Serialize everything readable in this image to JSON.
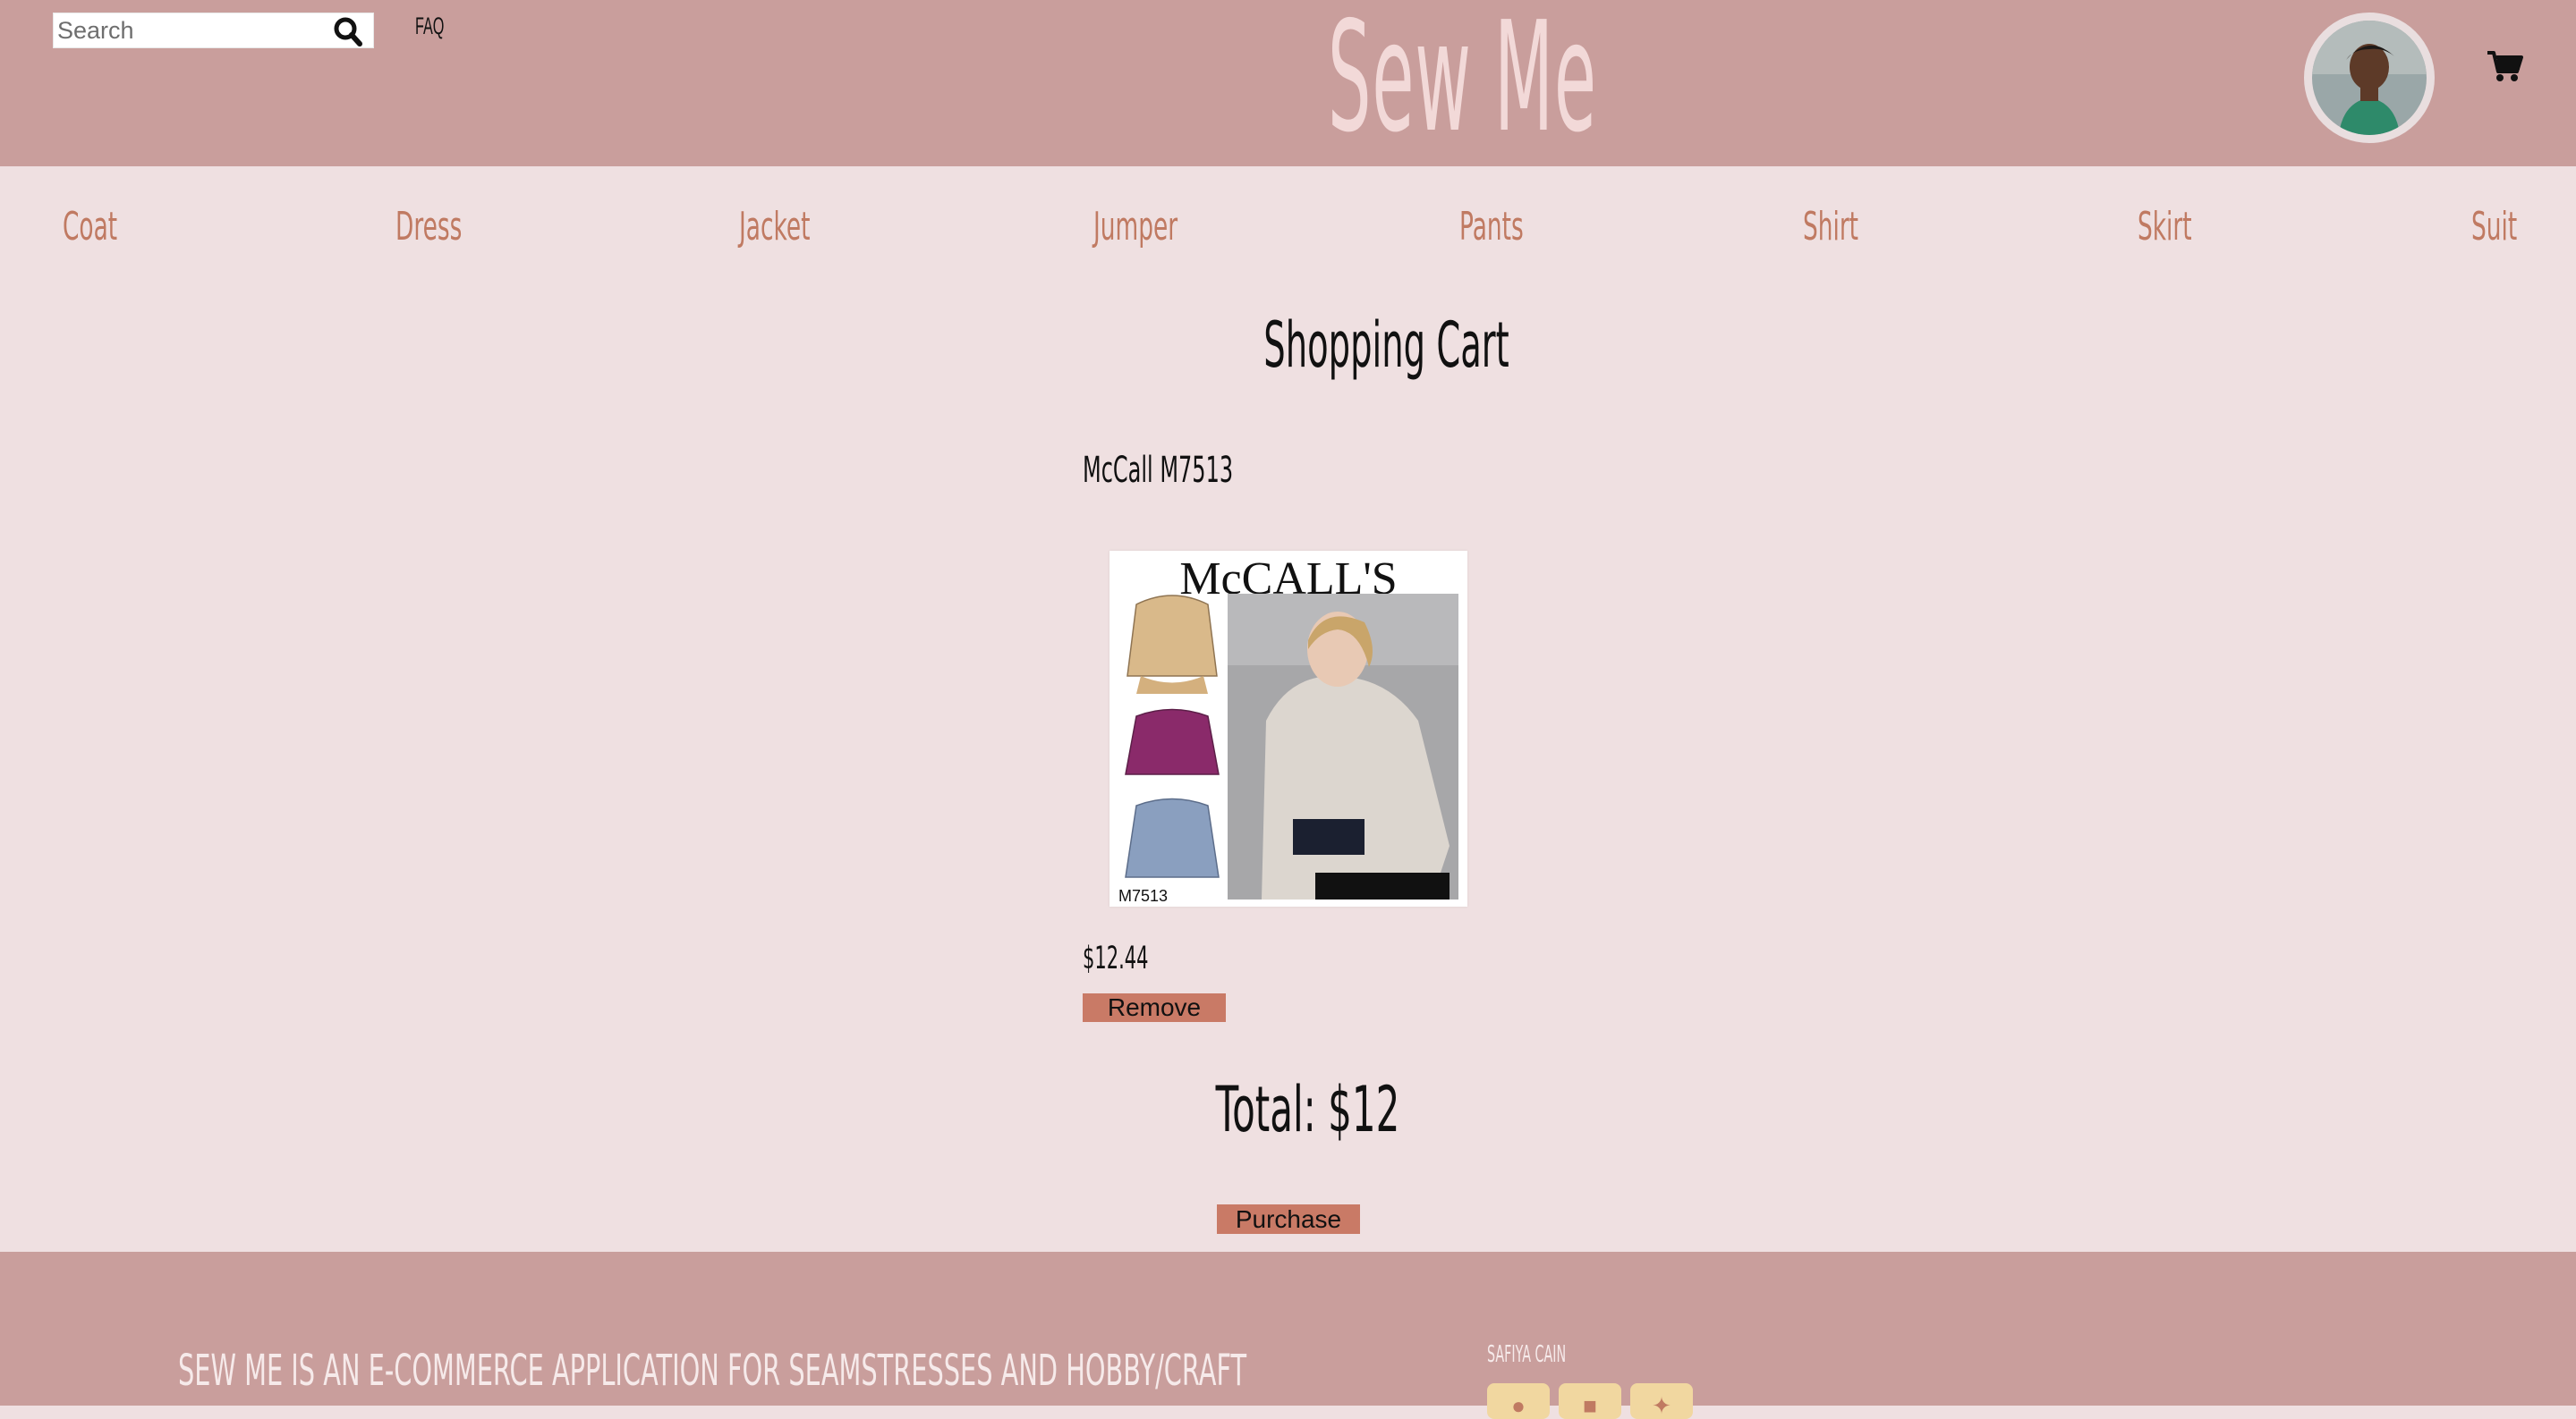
{
  "header": {
    "search_placeholder": "Search",
    "faq_label": "FAQ",
    "brand": "Sew Me",
    "search_icon": "search-icon",
    "cart_icon": "shopping-cart-icon"
  },
  "nav": {
    "items": [
      {
        "label": "Coat"
      },
      {
        "label": "Dress"
      },
      {
        "label": "Jacket"
      },
      {
        "label": "Jumper"
      },
      {
        "label": "Pants"
      },
      {
        "label": "Shirt"
      },
      {
        "label": "Skirt"
      },
      {
        "label": "Suit"
      }
    ]
  },
  "cart": {
    "title": "Shopping Cart",
    "item": {
      "name": "McCall M7513",
      "image_brand": "McCALL'S",
      "image_code": "M7513",
      "price": "$12.44",
      "remove_label": "Remove"
    },
    "total": "Total: $12",
    "purchase_label": "Purchase"
  },
  "footer": {
    "description": "SEW ME IS AN E-COMMERCE APPLICATION FOR SEAMSTRESSES AND HOBBY/CRAFT",
    "author": "SAFIYA CAIN",
    "social_icons": [
      "github-icon",
      "linkedin-icon",
      "angellist-icon"
    ]
  },
  "colors": {
    "header_bg": "#c99e9c",
    "page_bg": "#efe0e1",
    "nav_text": "#c07a62",
    "button_bg": "#c97a66"
  }
}
